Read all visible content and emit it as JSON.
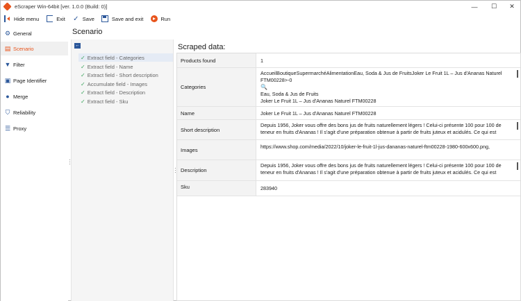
{
  "window": {
    "title": "eScraper Win-64bit [ver. 1.0.0 (Build: 0)]",
    "minimize": "—",
    "maximize": "☐",
    "close": "✕"
  },
  "toolbar": {
    "hide_menu": "Hide menu",
    "exit": "Exit",
    "save": "Save",
    "save_and_exit": "Save and exit",
    "run": "Run"
  },
  "nav": {
    "items": [
      {
        "label": "General",
        "icon": "gear-icon"
      },
      {
        "label": "Scenario",
        "icon": "scenario-icon"
      },
      {
        "label": "Filter",
        "icon": "filter-icon"
      },
      {
        "label": "Page Identifier",
        "icon": "page-identifier-icon"
      },
      {
        "label": "Merge",
        "icon": "merge-icon"
      },
      {
        "label": "Reliability",
        "icon": "shield-icon"
      },
      {
        "label": "Proxy",
        "icon": "proxy-icon"
      }
    ],
    "active_index": 1
  },
  "scenario": {
    "title": "Scenario",
    "steps": [
      {
        "label": "Extract field - Categories"
      },
      {
        "label": "Extract field - Name"
      },
      {
        "label": "Extract field - Short description"
      },
      {
        "label": "Accumulate field - Images"
      },
      {
        "label": "Extract field - Description"
      },
      {
        "label": "Extract field - Sku"
      }
    ]
  },
  "scraped": {
    "title": "Scraped data:",
    "products_found_label": "Products found",
    "products_found_value": "1",
    "categories_label": "Categories",
    "categories_line1": "AccueilBoutiqueSupermarchéAlimentationEau, Soda & Jus de FruitsJoker Le Fruit 1L – Jus d'Ananas Naturel FTM00228>-0",
    "categories_line2": "Eau, Soda & Jus de Fruits",
    "categories_line3": "Joker Le Fruit 1L – Jus d'Ananas Naturel FTM00228",
    "name_label": "Name",
    "name_value": "Joker Le Fruit 1L – Jus d'Ananas Naturel FTM00228",
    "short_description_label": "Short description",
    "short_description_value": "Depuis 1956, Joker vous offre des bons jus de fruits naturellement légers ! Celui-ci présente 100 pour 100 de teneur en fruits d'Ananas ! Il s'agit d'une préparation obtenue à partir de fruits juteux et acidulés. Ce qui est",
    "images_label": "Images",
    "images_value": "https://www.shop.com/media/2022/10/joker-le-fruit-1l-jus-dananas-naturel-ftm00228-1980-600x600.png,",
    "description_label": "Description",
    "description_value": "Depuis 1956, Joker vous offre des bons jus de fruits naturellement légers ! Celui-ci présente 100 pour 100 de teneur en fruits d'Ananas ! Il s'agit d'une préparation obtenue à partir de fruits juteux et acidulés. Ce qui est",
    "sku_label": "Sku",
    "sku_value": "283940"
  },
  "colors": {
    "accent": "#e8541c",
    "brand_blue": "#2b579a",
    "check_green": "#3aa35b"
  }
}
